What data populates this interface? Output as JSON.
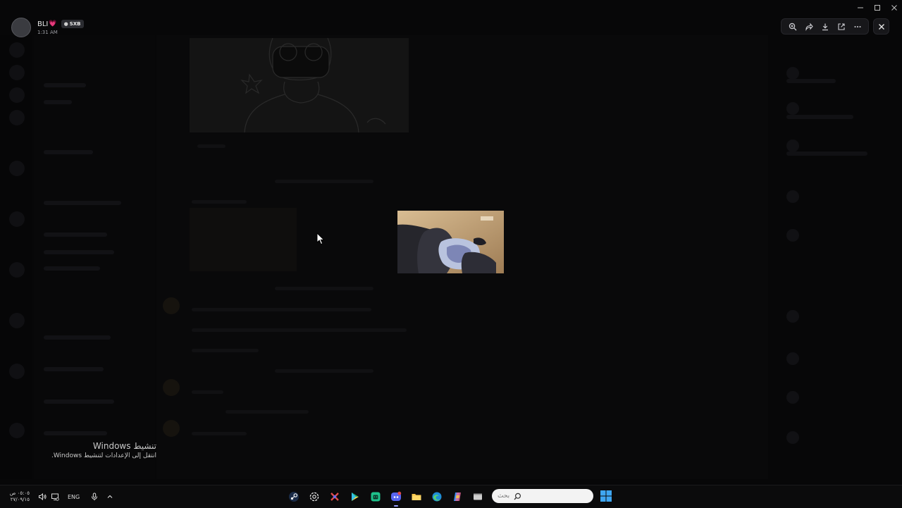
{
  "viewer": {
    "uploader_name": "BLI",
    "uploader_badge": "💗",
    "uploader_tag": "SXB",
    "timestamp": "1:31 AM",
    "toolbar_icons": [
      "zoom-icon",
      "forward-icon",
      "download-icon",
      "open-external-icon",
      "more-icon"
    ],
    "close_icon": "close-icon"
  },
  "watermark": {
    "title": "تنشيط Windows",
    "subtitle": "انتقل إلى الإعدادات لتنشيط Windows."
  },
  "taskbar": {
    "time": "٠٥:٠٥ ص",
    "date": "٢٧/٠٩/١٥",
    "language": "ENG",
    "search_placeholder": "بحث",
    "apps": [
      "steam-icon",
      "chatgpt-icon",
      "gamebar-icon",
      "google-play-games-icon",
      "android-icon",
      "discord-icon",
      "file-explorer-icon",
      "edge-icon",
      "copilot-icon",
      "window-icon"
    ]
  },
  "colors": {
    "background": "#050506",
    "taskbar": "#0b0b0c",
    "discord_accent": "#5865f2",
    "heart": "#e13a6c"
  }
}
